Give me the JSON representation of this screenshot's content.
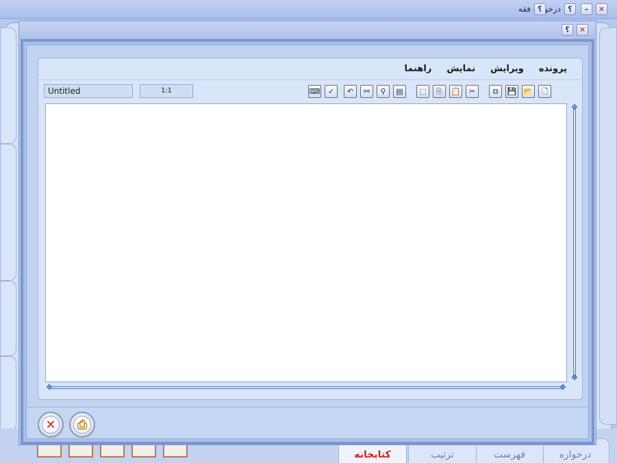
{
  "main_window": {
    "title": "درخواره فقه",
    "buttons": {
      "close": "✕",
      "minimize": "–",
      "help": "؟"
    }
  },
  "dialog": {
    "buttons": {
      "help": "؟",
      "close": "✕"
    },
    "menu": [
      "پرونده",
      "ویرایش",
      "نمایش",
      "راهنما"
    ],
    "document_title": "Untitled",
    "zoom": "1:1",
    "toolbar_icons": [
      {
        "name": "new-document-icon",
        "glyph": "🗋"
      },
      {
        "name": "open-folder-icon",
        "glyph": "📂"
      },
      {
        "name": "save-icon",
        "glyph": "💾"
      },
      {
        "name": "save-as-icon",
        "glyph": "⧉"
      },
      {
        "name": "cut-icon",
        "glyph": "✂"
      },
      {
        "name": "paste-icon",
        "glyph": "📋"
      },
      {
        "name": "copy-icon",
        "glyph": "⎘"
      },
      {
        "name": "select-all-icon",
        "glyph": "⬚"
      },
      {
        "name": "page-setup-icon",
        "glyph": "▤"
      },
      {
        "name": "find-icon",
        "glyph": "⚲"
      },
      {
        "name": "find-replace-icon",
        "glyph": "⚯"
      },
      {
        "name": "undo-icon",
        "glyph": "↶"
      },
      {
        "name": "spell-check-icon",
        "glyph": "✓"
      },
      {
        "name": "keyboard-icon",
        "glyph": "⌨"
      }
    ],
    "footer": {
      "cancel_glyph": "✕",
      "print_glyph": "⎙"
    }
  },
  "bottom_tabs": [
    "درخواره",
    "فهرست",
    "ترتیب",
    "کتابخانه"
  ],
  "colors": {
    "accent": "#7c97cc",
    "active_tab": "#d0241c",
    "cancel": "#d02020"
  }
}
